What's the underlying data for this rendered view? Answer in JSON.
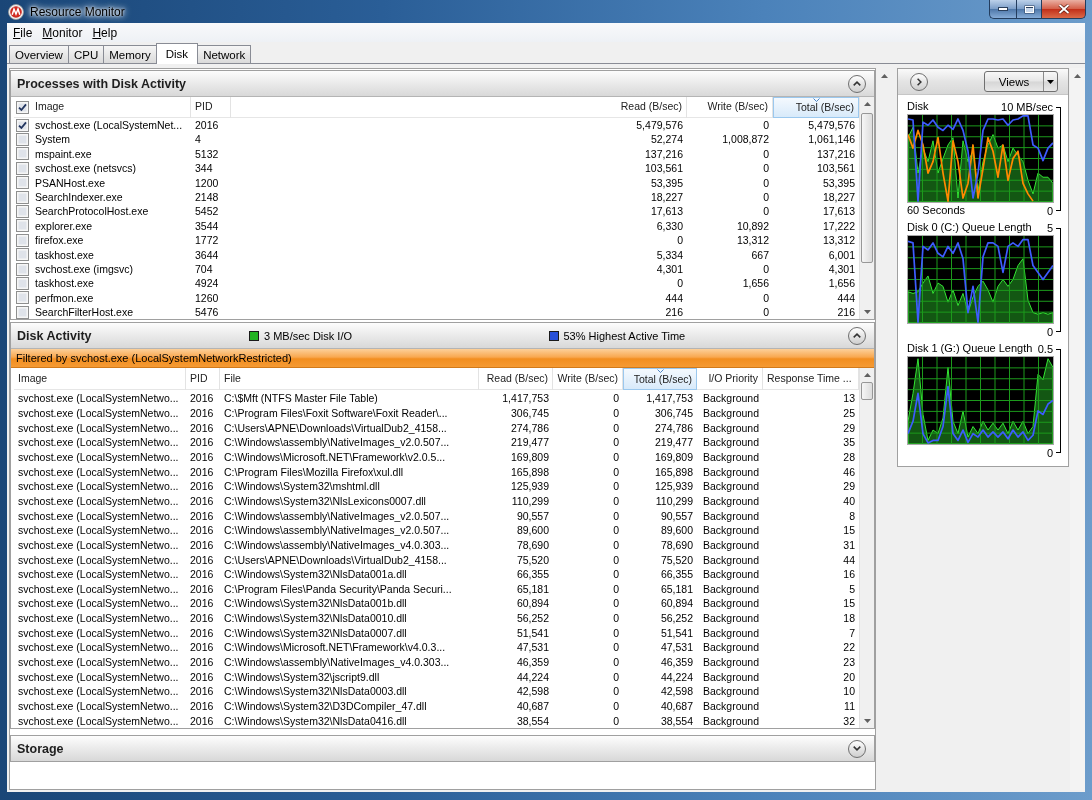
{
  "window": {
    "title": "Resource Monitor"
  },
  "menu": [
    "File",
    "Monitor",
    "Help"
  ],
  "tabs": [
    {
      "label": "Overview",
      "selected": false
    },
    {
      "label": "CPU",
      "selected": false
    },
    {
      "label": "Memory",
      "selected": false
    },
    {
      "label": "Disk",
      "selected": true
    },
    {
      "label": "Network",
      "selected": false
    }
  ],
  "processes": {
    "title": "Processes with Disk Activity",
    "expanded": true,
    "all_checked": true,
    "columns": [
      {
        "label": "Image",
        "sorted": false
      },
      {
        "label": "PID",
        "sorted": false
      },
      {
        "label": "Read (B/sec)",
        "sorted": false
      },
      {
        "label": "Write (B/sec)",
        "sorted": false
      },
      {
        "label": "Total (B/sec)",
        "sorted": true
      }
    ],
    "rows": [
      {
        "checked": true,
        "cells": [
          "svchost.exe (LocalSystemNet...",
          "2016",
          "5,479,576",
          "0",
          "5,479,576"
        ]
      },
      {
        "checked": false,
        "cells": [
          "System",
          "4",
          "52,274",
          "1,008,872",
          "1,061,146"
        ]
      },
      {
        "checked": false,
        "cells": [
          "mspaint.exe",
          "5132",
          "137,216",
          "0",
          "137,216"
        ]
      },
      {
        "checked": false,
        "cells": [
          "svchost.exe (netsvcs)",
          "344",
          "103,561",
          "0",
          "103,561"
        ]
      },
      {
        "checked": false,
        "cells": [
          "PSANHost.exe",
          "1200",
          "53,395",
          "0",
          "53,395"
        ]
      },
      {
        "checked": false,
        "cells": [
          "SearchIndexer.exe",
          "2148",
          "18,227",
          "0",
          "18,227"
        ]
      },
      {
        "checked": false,
        "cells": [
          "SearchProtocolHost.exe",
          "5452",
          "17,613",
          "0",
          "17,613"
        ]
      },
      {
        "checked": false,
        "cells": [
          "explorer.exe",
          "3544",
          "6,330",
          "10,892",
          "17,222"
        ]
      },
      {
        "checked": false,
        "cells": [
          "firefox.exe",
          "1772",
          "0",
          "13,312",
          "13,312"
        ]
      },
      {
        "checked": false,
        "cells": [
          "taskhost.exe",
          "3644",
          "5,334",
          "667",
          "6,001"
        ]
      },
      {
        "checked": false,
        "cells": [
          "svchost.exe (imgsvc)",
          "704",
          "4,301",
          "0",
          "4,301"
        ]
      },
      {
        "checked": false,
        "cells": [
          "taskhost.exe",
          "4924",
          "0",
          "1,656",
          "1,656"
        ]
      },
      {
        "checked": false,
        "cells": [
          "perfmon.exe",
          "1260",
          "444",
          "0",
          "444"
        ]
      },
      {
        "checked": false,
        "cells": [
          "SearchFilterHost.exe",
          "5476",
          "216",
          "0",
          "216"
        ]
      }
    ]
  },
  "disk_activity": {
    "title": "Disk Activity",
    "expanded": true,
    "legend": [
      {
        "label": "3 MB/sec Disk I/O",
        "color": "#22b422"
      },
      {
        "label": "53% Highest Active Time",
        "color": "#2850d8"
      }
    ],
    "filter": "Filtered by svchost.exe (LocalSystemNetworkRestricted)",
    "columns": [
      {
        "label": "Image",
        "sorted": false
      },
      {
        "label": "PID",
        "sorted": false
      },
      {
        "label": "File",
        "sorted": false
      },
      {
        "label": "Read (B/sec)",
        "sorted": false
      },
      {
        "label": "Write (B/sec)",
        "sorted": false
      },
      {
        "label": "Total (B/sec)",
        "sorted": true
      },
      {
        "label": "I/O Priority",
        "sorted": false
      },
      {
        "label": "Response Time ...",
        "sorted": false
      }
    ],
    "rows": [
      [
        "svchost.exe (LocalSystemNetwo...",
        "2016",
        "C:\\$Mft (NTFS Master File Table)",
        "1,417,753",
        "0",
        "1,417,753",
        "Background",
        "13"
      ],
      [
        "svchost.exe (LocalSystemNetwo...",
        "2016",
        "C:\\Program Files\\Foxit Software\\Foxit Reader\\...",
        "306,745",
        "0",
        "306,745",
        "Background",
        "25"
      ],
      [
        "svchost.exe (LocalSystemNetwo...",
        "2016",
        "C:\\Users\\APNE\\Downloads\\VirtualDub2_4158...",
        "274,786",
        "0",
        "274,786",
        "Background",
        "29"
      ],
      [
        "svchost.exe (LocalSystemNetwo...",
        "2016",
        "C:\\Windows\\assembly\\NativeImages_v2.0.507...",
        "219,477",
        "0",
        "219,477",
        "Background",
        "35"
      ],
      [
        "svchost.exe (LocalSystemNetwo...",
        "2016",
        "C:\\Windows\\Microsoft.NET\\Framework\\v2.0.5...",
        "169,809",
        "0",
        "169,809",
        "Background",
        "28"
      ],
      [
        "svchost.exe (LocalSystemNetwo...",
        "2016",
        "C:\\Program Files\\Mozilla Firefox\\xul.dll",
        "165,898",
        "0",
        "165,898",
        "Background",
        "46"
      ],
      [
        "svchost.exe (LocalSystemNetwo...",
        "2016",
        "C:\\Windows\\System32\\mshtml.dll",
        "125,939",
        "0",
        "125,939",
        "Background",
        "29"
      ],
      [
        "svchost.exe (LocalSystemNetwo...",
        "2016",
        "C:\\Windows\\System32\\NlsLexicons0007.dll",
        "110,299",
        "0",
        "110,299",
        "Background",
        "40"
      ],
      [
        "svchost.exe (LocalSystemNetwo...",
        "2016",
        "C:\\Windows\\assembly\\NativeImages_v2.0.507...",
        "90,557",
        "0",
        "90,557",
        "Background",
        "8"
      ],
      [
        "svchost.exe (LocalSystemNetwo...",
        "2016",
        "C:\\Windows\\assembly\\NativeImages_v2.0.507...",
        "89,600",
        "0",
        "89,600",
        "Background",
        "15"
      ],
      [
        "svchost.exe (LocalSystemNetwo...",
        "2016",
        "C:\\Windows\\assembly\\NativeImages_v4.0.303...",
        "78,690",
        "0",
        "78,690",
        "Background",
        "31"
      ],
      [
        "svchost.exe (LocalSystemNetwo...",
        "2016",
        "C:\\Users\\APNE\\Downloads\\VirtualDub2_4158...",
        "75,520",
        "0",
        "75,520",
        "Background",
        "44"
      ],
      [
        "svchost.exe (LocalSystemNetwo...",
        "2016",
        "C:\\Windows\\System32\\NlsData001a.dll",
        "66,355",
        "0",
        "66,355",
        "Background",
        "16"
      ],
      [
        "svchost.exe (LocalSystemNetwo...",
        "2016",
        "C:\\Program Files\\Panda Security\\Panda Securi...",
        "65,181",
        "0",
        "65,181",
        "Background",
        "5"
      ],
      [
        "svchost.exe (LocalSystemNetwo...",
        "2016",
        "C:\\Windows\\System32\\NlsData001b.dll",
        "60,894",
        "0",
        "60,894",
        "Background",
        "15"
      ],
      [
        "svchost.exe (LocalSystemNetwo...",
        "2016",
        "C:\\Windows\\System32\\NlsData0010.dll",
        "56,252",
        "0",
        "56,252",
        "Background",
        "18"
      ],
      [
        "svchost.exe (LocalSystemNetwo...",
        "2016",
        "C:\\Windows\\System32\\NlsData0007.dll",
        "51,541",
        "0",
        "51,541",
        "Background",
        "7"
      ],
      [
        "svchost.exe (LocalSystemNetwo...",
        "2016",
        "C:\\Windows\\Microsoft.NET\\Framework\\v4.0.3...",
        "47,531",
        "0",
        "47,531",
        "Background",
        "22"
      ],
      [
        "svchost.exe (LocalSystemNetwo...",
        "2016",
        "C:\\Windows\\assembly\\NativeImages_v4.0.303...",
        "46,359",
        "0",
        "46,359",
        "Background",
        "23"
      ],
      [
        "svchost.exe (LocalSystemNetwo...",
        "2016",
        "C:\\Windows\\System32\\jscript9.dll",
        "44,224",
        "0",
        "44,224",
        "Background",
        "20"
      ],
      [
        "svchost.exe (LocalSystemNetwo...",
        "2016",
        "C:\\Windows\\System32\\NlsData0003.dll",
        "42,598",
        "0",
        "42,598",
        "Background",
        "10"
      ],
      [
        "svchost.exe (LocalSystemNetwo...",
        "2016",
        "C:\\Windows\\System32\\D3DCompiler_47.dll",
        "40,687",
        "0",
        "40,687",
        "Background",
        "11"
      ],
      [
        "svchost.exe (LocalSystemNetwo...",
        "2016",
        "C:\\Windows\\System32\\NlsData0416.dll",
        "38,554",
        "0",
        "38,554",
        "Background",
        "32"
      ]
    ]
  },
  "storage": {
    "title": "Storage",
    "expanded": false
  },
  "side_panel": {
    "views_button": "Views",
    "chart_data": [
      {
        "type": "line",
        "title": "Disk",
        "xlabel": "60 Seconds",
        "ylim": [
          0,
          10
        ],
        "yticks": [
          {
            "value": 0,
            "label": "0"
          },
          {
            "value": 10,
            "label": "10 MB/sec"
          }
        ],
        "grid": true,
        "series": [
          {
            "type": "area",
            "color": "#33e633",
            "values": [
              7.0,
              8.0,
              3.6,
              6.0,
              4.7,
              6.7,
              3.6,
              5.0,
              6.3,
              7.0,
              1.2,
              6.7,
              4.7,
              5.7,
              1.9,
              4.7,
              6.3,
              7.3,
              6.0,
              6.3,
              4.7,
              6.0,
              5.3,
              4.7,
              2.9,
              1.6,
              3.6,
              3.2,
              3.2,
              2.6
            ]
          },
          {
            "color": "#ff8a00",
            "values": [
              7.3,
              6.0,
              7.7,
              6.3,
              3.6,
              4.7,
              7.0,
              3.6,
              0.9,
              6.7,
              4.7,
              1.2,
              2.6,
              6.3,
              1.2,
              4.0,
              7.0,
              5.7,
              3.2,
              6.3,
              2.9,
              5.0,
              5.7,
              2.6,
              1.6,
              0.9,
              null,
              null,
              null,
              null
            ]
          },
          {
            "color": "#3d5cff",
            "values": [
              8.8,
              8.7,
              0.9,
              8.5,
              8.2,
              8.7,
              8.0,
              7.7,
              8.2,
              7.8,
              8.8,
              7.7,
              5.7,
              1.2,
              3.6,
              7.7,
              8.8,
              8.8,
              8.7,
              8.8,
              8.2,
              8.7,
              8.8,
              9.1,
              9.1,
              6.3,
              6.0,
              4.8,
              6.0,
              6.5
            ]
          }
        ]
      },
      {
        "type": "line",
        "title": "Disk 0 (C:) Queue Length",
        "ylim": [
          0,
          5
        ],
        "yticks": [
          {
            "value": 0,
            "label": "0"
          },
          {
            "value": 5,
            "label": "5"
          }
        ],
        "grid": true,
        "series": [
          {
            "type": "area",
            "color": "#33e633",
            "values": [
              1.91,
              1.83,
              1.91,
              2.33,
              2.67,
              1.83,
              2.33,
              2.17,
              1.41,
              2.0,
              1.25,
              1.83,
              0.91,
              1.66,
              2.17,
              2.42,
              2.0,
              1.41,
              2.17,
              2.5,
              2.17,
              2.5,
              3.17,
              3.5,
              1.5,
              0.91,
              0.83,
              0.91,
              0.83,
              0.91
            ]
          },
          {
            "color": "#3d5cff",
            "values": [
              4.34,
              4.26,
              0.45,
              4.09,
              3.92,
              4.26,
              3.76,
              3.59,
              4.09,
              3.76,
              4.26,
              3.5,
              0.91,
              2.17,
              0.45,
              3.59,
              4.26,
              4.26,
              4.09,
              2.84,
              4.09,
              4.26,
              4.09,
              4.42,
              4.42,
              3.17,
              2.84,
              2.5,
              2.84,
              3.17
            ]
          }
        ]
      },
      {
        "type": "line",
        "title": "Disk 1 (G:) Queue Length",
        "ylim": [
          0,
          0.5
        ],
        "yticks": [
          {
            "value": 0,
            "label": "0"
          },
          {
            "value": 0.5,
            "label": "0.5"
          }
        ],
        "grid": true,
        "series": [
          {
            "type": "area",
            "color": "#33e633",
            "values": [
              0.15,
              0.284,
              0.451,
              0.183,
              0.058,
              0.108,
              0.091,
              0.166,
              0.409,
              0.15,
              0.091,
              0.2,
              0.074,
              0.125,
              0.091,
              0.15,
              0.108,
              0.141,
              0.108,
              0.141,
              0.091,
              0.15,
              0.108,
              0.15,
              0.091,
              0.125,
              0.376,
              0.35,
              0.451,
              0.409
            ]
          },
          {
            "color": "#3d5cff",
            "values": [
              0.091,
              0.15,
              0.284,
              0.091,
              0.046,
              0.058,
              0.058,
              0.125,
              0.317,
              0.091,
              0.058,
              0.108,
              0.049,
              0.091,
              0.074,
              0.108,
              0.074,
              0.099,
              0.074,
              0.099,
              0.066,
              0.108,
              0.074,
              0.099,
              0.058,
              0.083,
              0.2,
              0.183,
              0.233,
              0.25
            ]
          }
        ]
      }
    ]
  }
}
